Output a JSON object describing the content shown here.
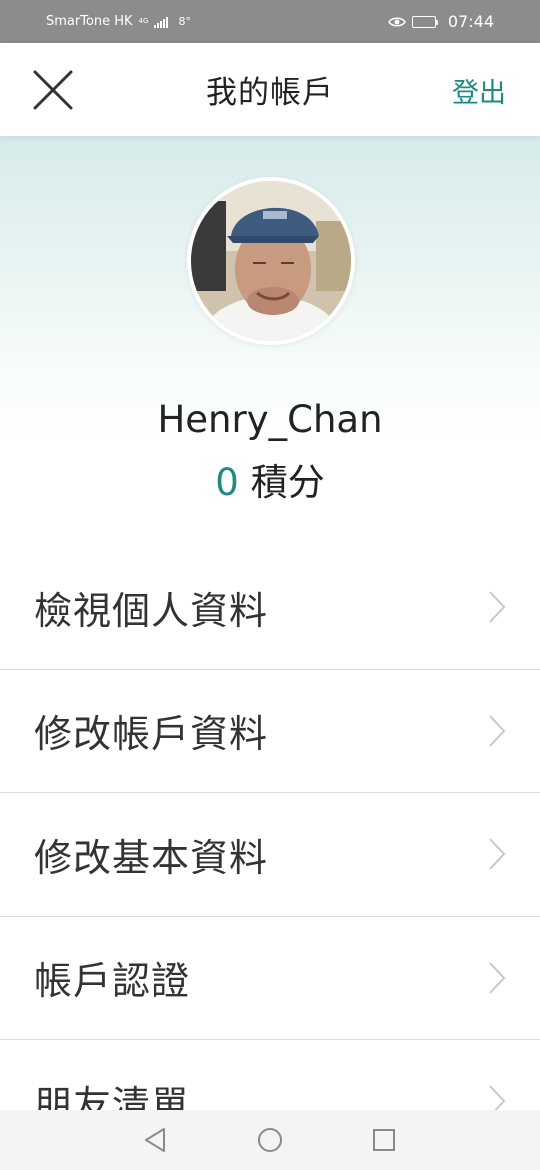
{
  "status_bar": {
    "carrier": "SmarTone HK",
    "network_badge": "4G",
    "temperature": "8°",
    "time": "07:44",
    "icons": [
      "signal-icon",
      "eye-icon",
      "battery-icon"
    ]
  },
  "header": {
    "title": "我的帳戶",
    "logout_label": "登出",
    "close_icon": "close-icon"
  },
  "profile": {
    "username": "Henry_Chan",
    "points": "0",
    "points_label": "積分"
  },
  "menu": {
    "items": [
      {
        "label": "檢視個人資料",
        "icon": "chevron-right-icon"
      },
      {
        "label": "修改帳戶資料",
        "icon": "chevron-right-icon"
      },
      {
        "label": "修改基本資料",
        "icon": "chevron-right-icon"
      },
      {
        "label": "帳戶認證",
        "icon": "chevron-right-icon"
      },
      {
        "label": "朋友清單",
        "icon": "chevron-right-icon"
      }
    ]
  },
  "nav_bar": {
    "icons": [
      "back-triangle-icon",
      "home-circle-icon",
      "recent-square-icon"
    ]
  },
  "colors": {
    "accent": "#1f8a7f",
    "status_bar": "#8c8c8c",
    "divider": "#dcdcdc",
    "hero_top": "#d6ecea"
  }
}
